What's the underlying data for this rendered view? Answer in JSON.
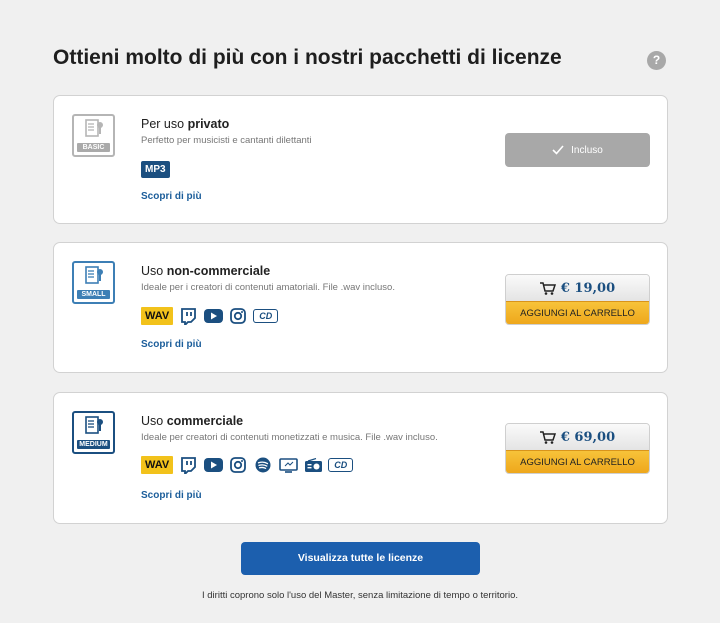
{
  "title": "Ottieni molto di più con i nostri pacchetti di licenze",
  "help_label": "?",
  "packages": [
    {
      "tag": "BASIC",
      "name_prefix": "Per uso ",
      "name_bold": "privato",
      "description": "Perfetto per musicisti e cantanti dilettanti",
      "format": "MP3",
      "more_link": "Scopri di più",
      "status": "Incluso"
    },
    {
      "tag": "SMALL",
      "name_prefix": "Uso ",
      "name_bold": "non-commerciale",
      "description": "Ideale per i creatori di contenuti amatoriali. File .wav incluso.",
      "format": "WAV",
      "platforms": [
        "twitch-icon",
        "youtube-icon",
        "instagram-icon",
        "cd-icon"
      ],
      "cd_label": "CD",
      "more_link": "Scopri di più",
      "price": "€ 19,00",
      "cart_label": "AGGIUNGI AL CARRELLO"
    },
    {
      "tag": "MEDIUM",
      "name_prefix": "Uso ",
      "name_bold": "commerciale",
      "description": "Ideale per creatori di contenuti monetizzati e musica. File .wav incluso.",
      "format": "WAV",
      "platforms": [
        "twitch-icon",
        "youtube-icon",
        "instagram-icon",
        "spotify-icon",
        "tv-icon",
        "radio-icon",
        "cd-icon"
      ],
      "cd_label": "CD",
      "more_link": "Scopri di più",
      "price": "€ 69,00",
      "cart_label": "AGGIUNGI AL CARRELLO"
    }
  ],
  "view_all_label": "Visualizza tutte le licenze",
  "footer": "I diritti coprono solo l'uso del Master, senza limitazione di tempo o territorio.",
  "colors": {
    "brand_blue": "#1b4f80",
    "button_blue": "#1c5fae",
    "cart_orange": "#eea61a",
    "wav_yellow": "#f2c21b"
  }
}
